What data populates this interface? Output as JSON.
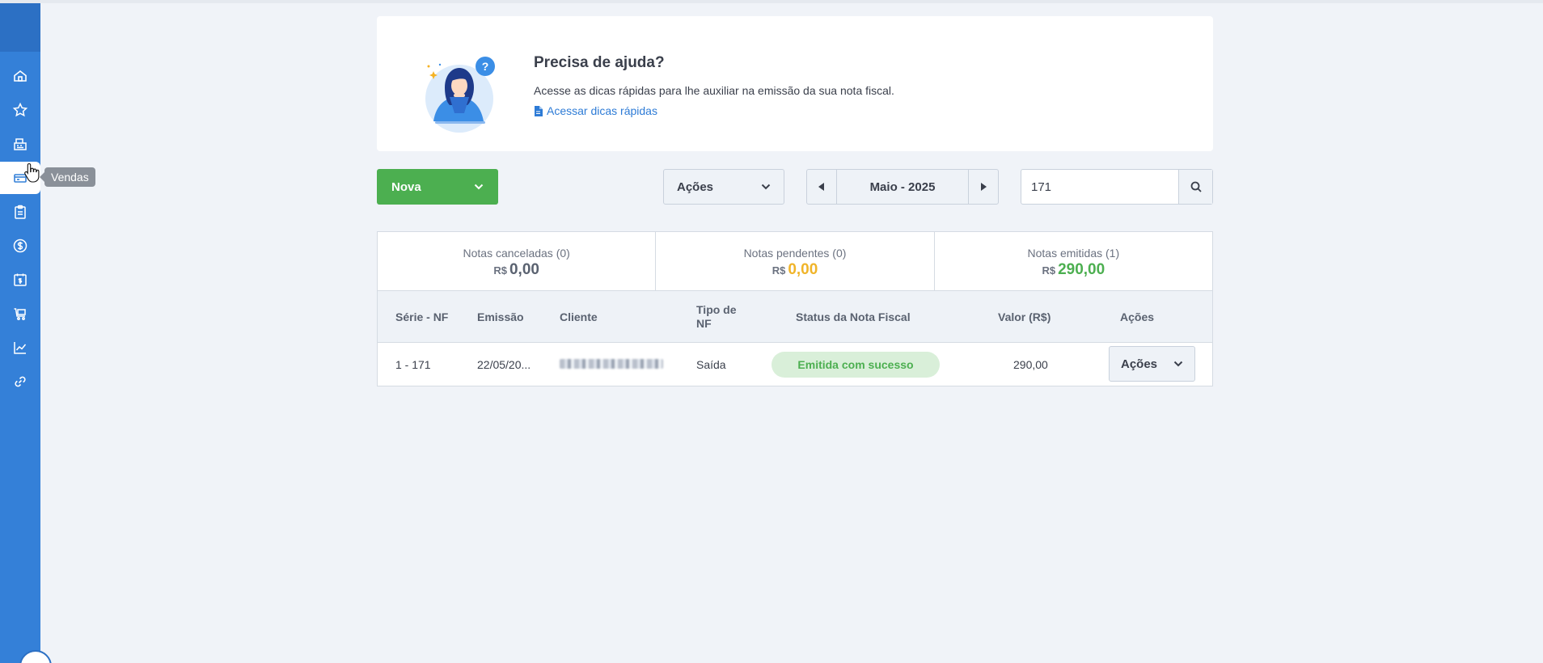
{
  "sidebar": {
    "items": [
      {
        "icon": "home-icon"
      },
      {
        "icon": "star-icon"
      },
      {
        "icon": "cash-register-icon"
      },
      {
        "icon": "sales-icon",
        "active": true
      },
      {
        "icon": "clipboard-icon"
      },
      {
        "icon": "dollar-icon"
      },
      {
        "icon": "calendar-dollar-icon"
      },
      {
        "icon": "cart-icon"
      },
      {
        "icon": "chart-line-icon"
      },
      {
        "icon": "link-icon"
      }
    ],
    "tooltip": "Vendas"
  },
  "help": {
    "title": "Precisa de ajuda?",
    "description": "Acesse as dicas rápidas para lhe auxiliar na emissão da sua nota fiscal.",
    "link": "Acessar dicas rápidas"
  },
  "toolbar": {
    "new_label": "Nova",
    "actions_label": "Ações",
    "month_label": "Maio - 2025",
    "search_value": "171"
  },
  "summary": [
    {
      "label": "Notas canceladas (0)",
      "currency": "R$",
      "value": "0,00",
      "color": "#5a6270"
    },
    {
      "label": "Notas pendentes (0)",
      "currency": "R$",
      "value": "0,00",
      "color": "#f0b429"
    },
    {
      "label": "Notas emitidas (1)",
      "currency": "R$",
      "value": "290,00",
      "color": "#4caf50"
    }
  ],
  "table": {
    "headers": {
      "serie": "Série - NF",
      "emissao": "Emissão",
      "cliente": "Cliente",
      "tipo": "Tipo de NF",
      "status": "Status da Nota Fiscal",
      "valor": "Valor (R$)",
      "acoes": "Ações"
    },
    "rows": [
      {
        "serie": "1 - 171",
        "emissao": "22/05/20...",
        "tipo": "Saída",
        "status": "Emitida com sucesso",
        "valor": "290,00",
        "acoes": "Ações"
      }
    ]
  },
  "colors": {
    "sidebar": "#3480d8",
    "primary_green": "#4caf50",
    "link_blue": "#2d7bd6",
    "pending_yellow": "#f0b429"
  }
}
